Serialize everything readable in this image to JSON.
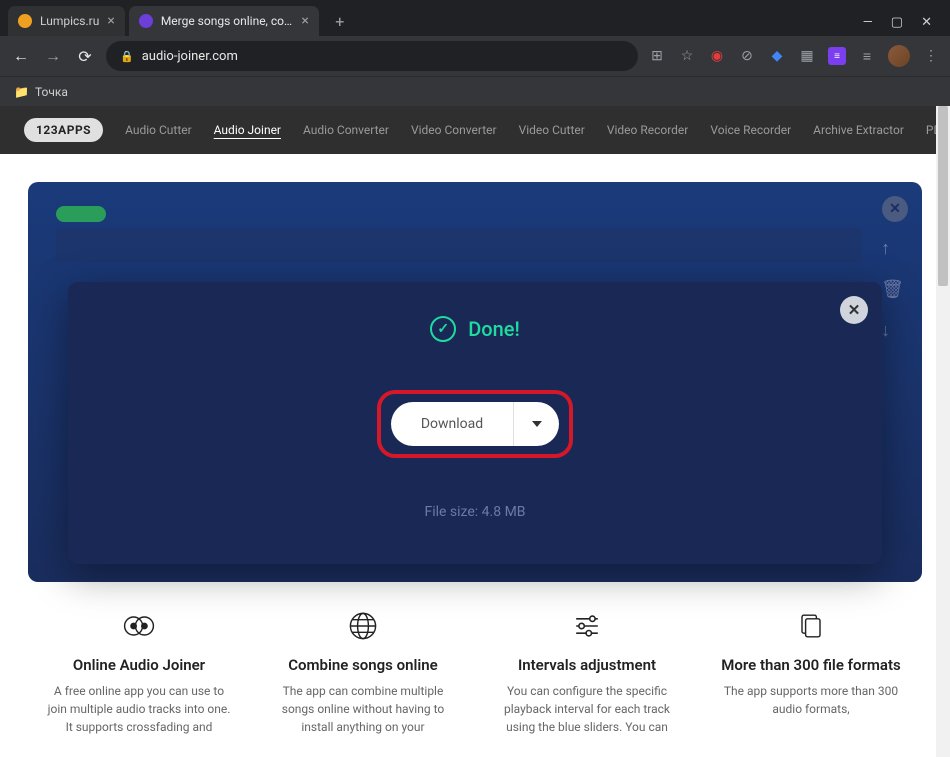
{
  "browser": {
    "tabs": [
      {
        "label": "Lumpics.ru",
        "favicon_color": "#f0a020"
      },
      {
        "label": "Merge songs online, combine m...",
        "favicon_color": "#6b3fd8"
      }
    ],
    "url": "audio-joiner.com",
    "bookmark": "Точка"
  },
  "nav": {
    "logo": "123APPS",
    "items": [
      "Audio Cutter",
      "Audio Joiner",
      "Audio Converter",
      "Video Converter",
      "Video Cutter",
      "Video Recorder",
      "Voice Recorder",
      "Archive Extractor",
      "PDF Tools"
    ],
    "active_index": 1
  },
  "modal": {
    "done_label": "Done!",
    "download_label": "Download",
    "filesize_label": "File size: 4.8 MB",
    "filesize_value": "4.8 MB"
  },
  "features": [
    {
      "title": "Online Audio Joiner",
      "desc": "A free online app you can use to join multiple audio tracks into one. It supports crossfading and"
    },
    {
      "title": "Combine songs online",
      "desc": "The app can combine multiple songs online without having to install anything on your"
    },
    {
      "title": "Intervals adjustment",
      "desc": "You can configure the specific playback interval for each track using the blue sliders. You can"
    },
    {
      "title": "More than 300 file formats",
      "desc": "The app supports more than 300 audio formats,"
    }
  ]
}
